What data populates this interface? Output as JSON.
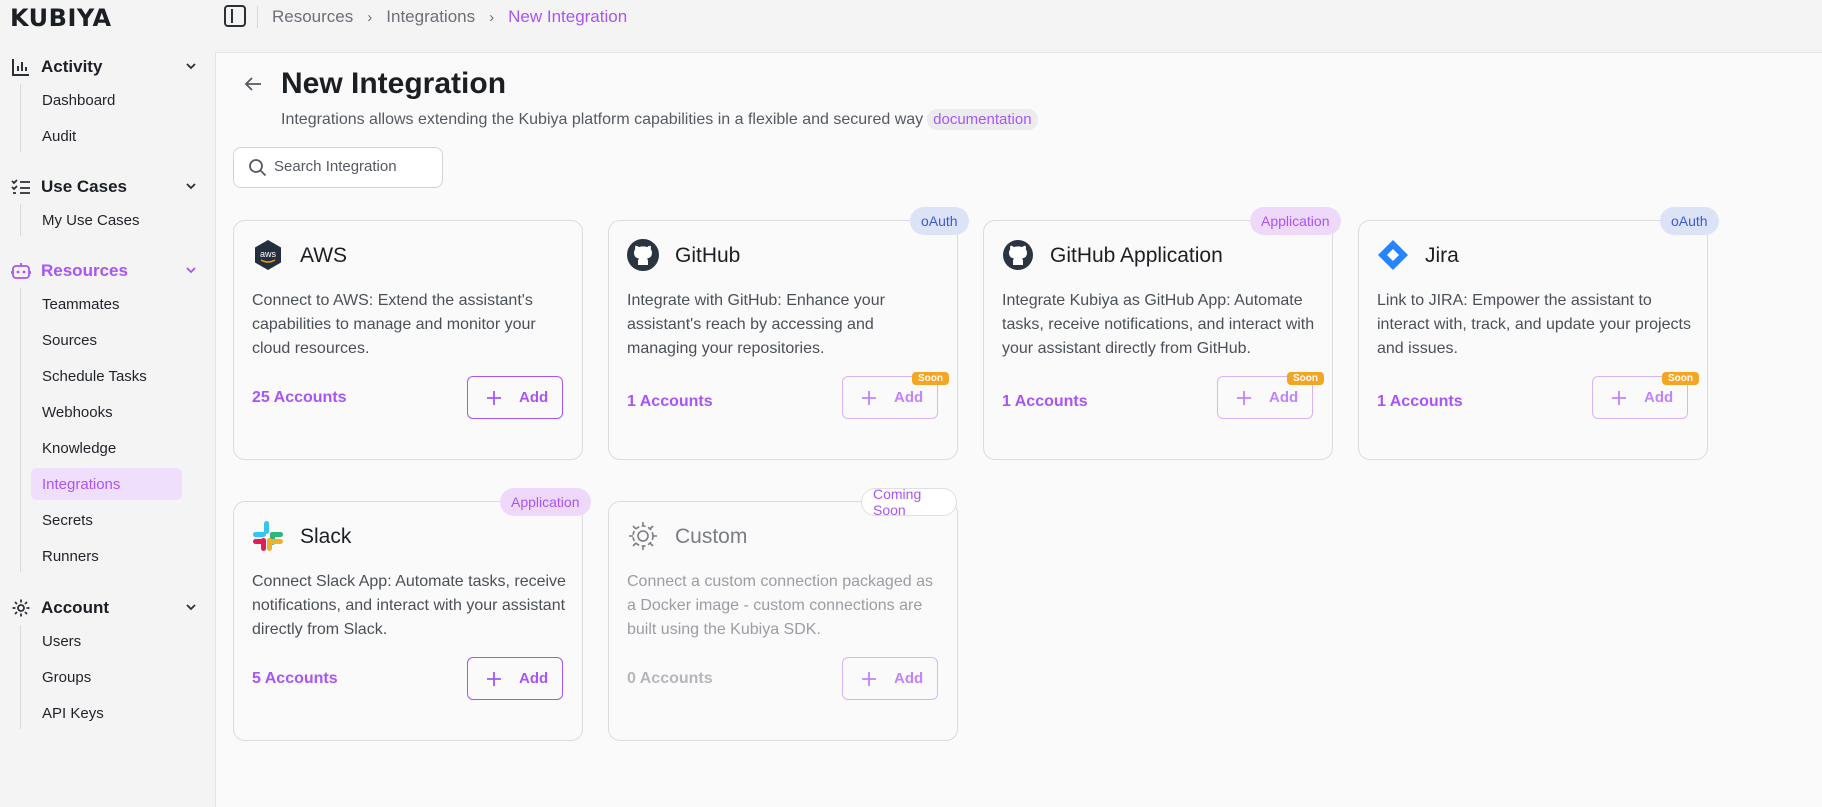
{
  "brand": {
    "logo_text": "KUBIYA"
  },
  "breadcrumb": {
    "items": [
      "Resources",
      "Integrations"
    ],
    "current": "New Integration"
  },
  "sidebar": {
    "sections": [
      {
        "label": "Activity",
        "items": [
          "Dashboard",
          "Audit"
        ]
      },
      {
        "label": "Use Cases",
        "items": [
          "My Use Cases"
        ]
      },
      {
        "label": "Resources",
        "items": [
          "Teammates",
          "Sources",
          "Schedule Tasks",
          "Webhooks",
          "Knowledge",
          "Integrations",
          "Secrets",
          "Runners"
        ]
      },
      {
        "label": "Account",
        "items": [
          "Users",
          "Groups",
          "API Keys"
        ]
      }
    ],
    "active_item": "Integrations"
  },
  "page": {
    "title": "New Integration",
    "subtitle": "Integrations allows extending the Kubiya platform capabilities in a flexible and secured way",
    "doc_link": "documentation"
  },
  "search": {
    "placeholder": "Search Integration",
    "value": ""
  },
  "cards": [
    {
      "title": "AWS",
      "icon": "aws-icon",
      "tag": "",
      "description": "Connect to AWS: Extend the assistant's capabilities to manage and monitor your cloud resources.",
      "accounts": "25 Accounts",
      "add_label": "Add",
      "soon": ""
    },
    {
      "title": "GitHub",
      "icon": "github-icon",
      "tag": "oAuth",
      "description": "Integrate with GitHub: Enhance your assistant's reach by accessing and managing your repositories.",
      "accounts": "1 Accounts",
      "add_label": "Add",
      "soon": "Soon"
    },
    {
      "title": "GitHub Application",
      "icon": "github-icon",
      "tag": "Application",
      "description": "Integrate Kubiya as GitHub App: Automate tasks, receive notifications, and interact with your assistant directly from GitHub.",
      "accounts": "1 Accounts",
      "add_label": "Add",
      "soon": "Soon"
    },
    {
      "title": "Jira",
      "icon": "jira-icon",
      "tag": "oAuth",
      "description": "Link to JIRA: Empower the assistant to interact with, track, and update your projects and issues.",
      "accounts": "1 Accounts",
      "add_label": "Add",
      "soon": "Soon"
    },
    {
      "title": "Slack",
      "icon": "slack-icon",
      "tag": "Application",
      "description": "Connect Slack App: Automate tasks, receive notifications, and interact with your assistant directly from Slack.",
      "accounts": "5 Accounts",
      "add_label": "Add",
      "soon": ""
    },
    {
      "title": "Custom",
      "icon": "custom-gear-icon",
      "tag": "Coming Soon",
      "description": "Connect a custom connection packaged as a Docker image - custom connections are built using the Kubiya SDK.",
      "accounts": "0 Accounts",
      "add_label": "Add",
      "soon": ""
    }
  ],
  "colors": {
    "accent": "#a855f7",
    "soon_badge": "#f5a524",
    "oauth_tag": "#3b5bd6"
  }
}
